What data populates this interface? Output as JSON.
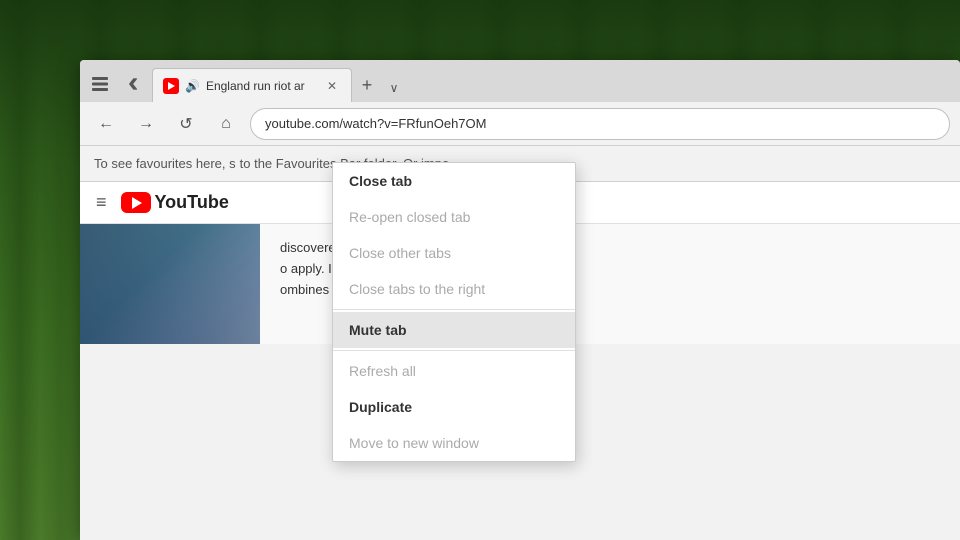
{
  "browser": {
    "tab": {
      "title": "England run riot ar",
      "audio_icon": "🔊",
      "close_icon": "✕"
    },
    "tab_new_icon": "+",
    "tab_chevron_icon": "∨",
    "toolbar": {
      "back_icon": "←",
      "forward_icon": "→",
      "refresh_icon": "↺",
      "home_icon": "⌂",
      "address": "youtube.com/watch?v=FRfunOeh7OM"
    },
    "favbar_text": "To see favourites here, s",
    "favbar_suffix": "to the Favourites Bar folder. Or impo"
  },
  "youtube": {
    "logo_text": "YouTube",
    "header_hamburger": "≡"
  },
  "context_menu": {
    "items": [
      {
        "id": "close-tab",
        "label": "Close tab",
        "disabled": false,
        "highlighted": false,
        "bold": false
      },
      {
        "id": "reopen-closed",
        "label": "Re-open closed tab",
        "disabled": true,
        "highlighted": false,
        "bold": false
      },
      {
        "id": "close-other",
        "label": "Close other tabs",
        "disabled": true,
        "highlighted": false,
        "bold": false
      },
      {
        "id": "close-right",
        "label": "Close tabs to the right",
        "disabled": true,
        "highlighted": false,
        "bold": false
      },
      {
        "id": "separator1",
        "type": "separator"
      },
      {
        "id": "mute-tab",
        "label": "Mute tab",
        "disabled": false,
        "highlighted": true,
        "bold": true
      },
      {
        "id": "separator2",
        "type": "separator"
      },
      {
        "id": "refresh-all",
        "label": "Refresh all",
        "disabled": true,
        "highlighted": false,
        "bold": false
      },
      {
        "id": "duplicate",
        "label": "Duplicate",
        "disabled": false,
        "highlighted": false,
        "bold": true
      },
      {
        "id": "move-window",
        "label": "Move to new window",
        "disabled": true,
        "highlighted": false,
        "bold": false
      }
    ]
  },
  "page_text": {
    "line1": "discovered ShakesPeer was hiring,",
    "line2": "o apply. I've been waiting to find a",
    "line3": "ombines a strong culture and good"
  }
}
